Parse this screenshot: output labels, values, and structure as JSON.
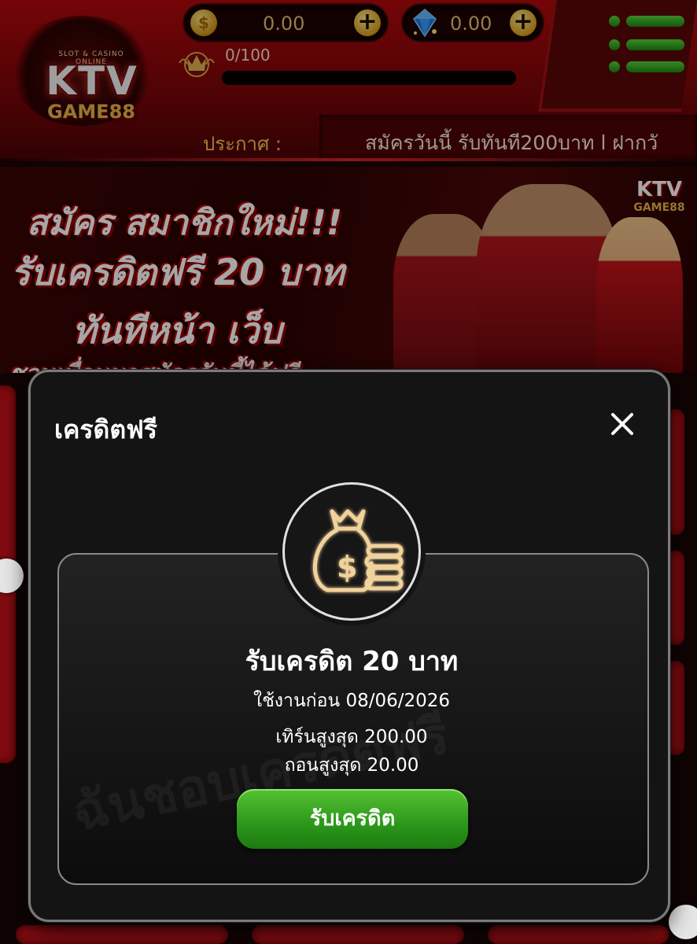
{
  "header": {
    "logo": {
      "top_text": "SLOT & CASINO ONLINE",
      "main": "KTV",
      "sub": "GAME88"
    },
    "wallet_coin": {
      "icon": "coin-icon",
      "value": "0.00"
    },
    "wallet_gem": {
      "icon": "gem-icon",
      "value": "0.00"
    },
    "plus_label": "+",
    "level": {
      "icon": "crown-icon",
      "text": "0/100",
      "progress_fraction": 0
    },
    "menu_icon": "hamburger-menu-icon",
    "announce_label": "ประกาศ :",
    "announce_text": "สมัครวันนี้ รับทันที200บาท l ฝากวั"
  },
  "banner": {
    "line1": "สมัคร สมาชิกใหม่!!!",
    "line2": "รับเครดิตฟรี 20 บาท",
    "line3": "ทันทีหน้า เว็บ",
    "line4": "ชวนเพื่อนมาสมัครวันนี้ได้ฟรี",
    "logo_main": "KTV",
    "logo_sub": "GAME88"
  },
  "modal": {
    "title": "เครดิตฟรี",
    "close_icon": "close-icon",
    "reward_icon": "money-bag-icon",
    "reward_title": "รับเครดิต 20 บาท",
    "expiry": "ใช้งานก่อน 08/06/2026",
    "max_turnover": "เทิร์นสูงสุด 200.00",
    "max_withdraw": "ถอนสูงสุด 20.00",
    "claim_button": "รับเครดิต",
    "watermark": "ฉันชอบเครดิตฟรี"
  },
  "colors": {
    "header_red": "#b3090c",
    "claim_green": "#2e9a1c",
    "gold": "#e7c06a",
    "modal_bg": "#141414"
  }
}
